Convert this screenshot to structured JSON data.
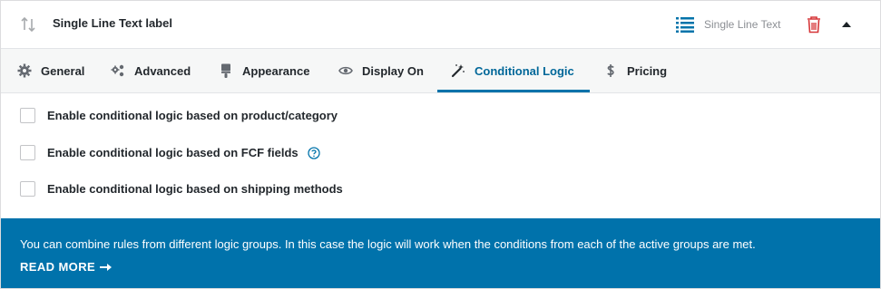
{
  "header": {
    "title": "Single Line Text label",
    "type_label": "Single Line Text",
    "icons": {
      "sort": "sort-arrows-icon",
      "type": "list-icon",
      "trash": "trash-icon",
      "collapse": "caret-up-icon"
    },
    "colors": {
      "type_icon": "#0073aa",
      "trash_icon": "#d63638"
    }
  },
  "tabs": [
    {
      "label": "General",
      "icon": "gear-icon"
    },
    {
      "label": "Advanced",
      "icon": "gears-icon"
    },
    {
      "label": "Appearance",
      "icon": "brush-icon"
    },
    {
      "label": "Display On",
      "icon": "eye-icon"
    },
    {
      "label": "Conditional Logic",
      "icon": "magic-wand-icon",
      "active": true
    },
    {
      "label": "Pricing",
      "icon": "dollar-icon"
    }
  ],
  "options": [
    {
      "label": "Enable conditional logic based on product/category",
      "checked": false
    },
    {
      "label": "Enable conditional logic based on FCF fields",
      "checked": false,
      "help_icon": "help-circle-icon"
    },
    {
      "label": "Enable conditional logic based on shipping methods",
      "checked": false
    }
  ],
  "info": {
    "text": "You can combine rules from different logic groups. In this case the logic will work when the conditions from each of the active groups are met.",
    "read_more": "READ MORE",
    "arrow_icon": "arrow-right-icon",
    "background": "#0072ab"
  }
}
